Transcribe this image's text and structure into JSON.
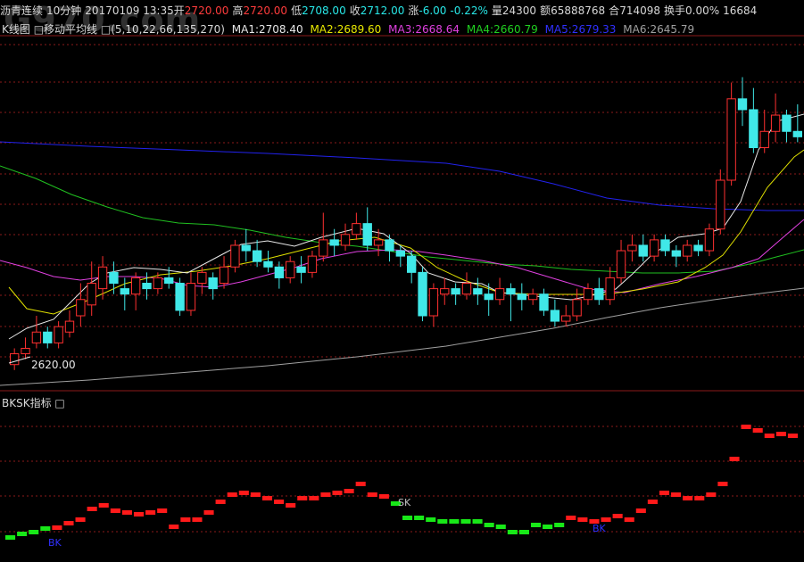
{
  "header": {
    "instrument": "沥青连续",
    "period": "10分钟",
    "datetime": "20170109 13:35",
    "open_label": "开",
    "open": "2720.00",
    "high_label": "高",
    "high": "2720.00",
    "low_label": "低",
    "low": "2708.00",
    "close_label": "收",
    "close": "2712.00",
    "change_label": "涨",
    "change": "-6.00",
    "change_pct": "-0.22%",
    "volume_label": "量",
    "volume": "24300",
    "amount_label": "额",
    "amount": "65888768",
    "oi_label": "合",
    "oi": "714098",
    "turnover_label": "换手",
    "turnover": "0.00%",
    "extra": "16684"
  },
  "ma_bar": {
    "kline_label": "K线图",
    "ma_name": "移动平均线",
    "params": "(5,10,22,66,135,270)",
    "ma1": "MA1:2708.40",
    "ma2": "MA2:2689.60",
    "ma3": "MA3:2668.64",
    "ma4": "MA4:2660.79",
    "ma5": "MA5:2679.33",
    "ma6": "MA6:2645.79",
    "colors": {
      "ma1": "#e8e8e8",
      "ma2": "#e8e800",
      "ma3": "#e040e0",
      "ma4": "#20d020",
      "ma5": "#2020ff",
      "ma6": "#b0b0b0"
    }
  },
  "sub_panel": {
    "title": "BKSK指标",
    "bk_label_1": "BK",
    "sk_label": "SK",
    "bk_label_2": "BK"
  },
  "price_annotation": "2620.00",
  "watermark": "G970.com",
  "chart_data": {
    "type": "candlestick",
    "ylim": [
      2615,
      2740
    ],
    "candles": [
      [
        2622,
        2626,
        2628,
        2620
      ],
      [
        2626,
        2628,
        2632,
        2624
      ],
      [
        2630,
        2634,
        2640,
        2628
      ],
      [
        2634,
        2630,
        2636,
        2628
      ],
      [
        2630,
        2636,
        2638,
        2628
      ],
      [
        2634,
        2638,
        2642,
        2632
      ],
      [
        2640,
        2646,
        2652,
        2636
      ],
      [
        2644,
        2652,
        2660,
        2640
      ],
      [
        2650,
        2658,
        2662,
        2646
      ],
      [
        2656,
        2652,
        2660,
        2648
      ],
      [
        2650,
        2648,
        2654,
        2642
      ],
      [
        2648,
        2654,
        2656,
        2642
      ],
      [
        2652,
        2650,
        2656,
        2646
      ],
      [
        2650,
        2654,
        2656,
        2648
      ],
      [
        2654,
        2652,
        2658,
        2650
      ],
      [
        2652,
        2642,
        2654,
        2640
      ],
      [
        2642,
        2652,
        2656,
        2640
      ],
      [
        2652,
        2656,
        2658,
        2648
      ],
      [
        2654,
        2650,
        2656,
        2646
      ],
      [
        2652,
        2658,
        2662,
        2650
      ],
      [
        2658,
        2666,
        2668,
        2656
      ],
      [
        2666,
        2664,
        2672,
        2660
      ],
      [
        2664,
        2660,
        2668,
        2658
      ],
      [
        2660,
        2658,
        2664,
        2656
      ],
      [
        2658,
        2654,
        2660,
        2650
      ],
      [
        2654,
        2660,
        2662,
        2652
      ],
      [
        2658,
        2656,
        2662,
        2652
      ],
      [
        2656,
        2662,
        2664,
        2654
      ],
      [
        2662,
        2668,
        2678,
        2660
      ],
      [
        2668,
        2666,
        2672,
        2662
      ],
      [
        2666,
        2670,
        2674,
        2664
      ],
      [
        2670,
        2674,
        2678,
        2668
      ],
      [
        2674,
        2666,
        2680,
        2664
      ],
      [
        2666,
        2668,
        2672,
        2662
      ],
      [
        2668,
        2664,
        2670,
        2660
      ],
      [
        2664,
        2662,
        2666,
        2658
      ],
      [
        2662,
        2656,
        2664,
        2652
      ],
      [
        2656,
        2640,
        2658,
        2638
      ],
      [
        2640,
        2650,
        2652,
        2636
      ],
      [
        2648,
        2650,
        2654,
        2644
      ],
      [
        2650,
        2648,
        2652,
        2644
      ],
      [
        2648,
        2652,
        2656,
        2646
      ],
      [
        2650,
        2648,
        2654,
        2644
      ],
      [
        2648,
        2646,
        2652,
        2640
      ],
      [
        2646,
        2650,
        2654,
        2644
      ],
      [
        2650,
        2648,
        2652,
        2638
      ],
      [
        2648,
        2646,
        2652,
        2642
      ],
      [
        2646,
        2648,
        2650,
        2644
      ],
      [
        2648,
        2642,
        2650,
        2640
      ],
      [
        2642,
        2638,
        2646,
        2636
      ],
      [
        2638,
        2640,
        2644,
        2636
      ],
      [
        2640,
        2646,
        2650,
        2638
      ],
      [
        2646,
        2650,
        2652,
        2644
      ],
      [
        2650,
        2646,
        2654,
        2644
      ],
      [
        2646,
        2654,
        2658,
        2644
      ],
      [
        2654,
        2664,
        2668,
        2652
      ],
      [
        2664,
        2666,
        2670,
        2660
      ],
      [
        2666,
        2662,
        2670,
        2660
      ],
      [
        2662,
        2668,
        2670,
        2660
      ],
      [
        2668,
        2664,
        2670,
        2662
      ],
      [
        2664,
        2662,
        2666,
        2658
      ],
      [
        2662,
        2666,
        2668,
        2660
      ],
      [
        2666,
        2664,
        2668,
        2662
      ],
      [
        2664,
        2672,
        2674,
        2662
      ],
      [
        2672,
        2690,
        2694,
        2670
      ],
      [
        2690,
        2720,
        2726,
        2688
      ],
      [
        2720,
        2716,
        2728,
        2710
      ],
      [
        2716,
        2702,
        2724,
        2700
      ],
      [
        2702,
        2708,
        2716,
        2700
      ],
      [
        2708,
        2714,
        2722,
        2704
      ],
      [
        2714,
        2708,
        2716,
        2704
      ],
      [
        2708,
        2706,
        2718,
        2704
      ]
    ]
  },
  "bksk_data": {
    "levels": [
      [
        -1,
        600
      ],
      [
        -1,
        596
      ],
      [
        -1,
        594
      ],
      [
        -1,
        590
      ],
      [
        1,
        589
      ],
      [
        1,
        584
      ],
      [
        1,
        580
      ],
      [
        1,
        568
      ],
      [
        1,
        564
      ],
      [
        1,
        570
      ],
      [
        1,
        572
      ],
      [
        1,
        574
      ],
      [
        1,
        572
      ],
      [
        1,
        570
      ],
      [
        1,
        588
      ],
      [
        1,
        580
      ],
      [
        1,
        580
      ],
      [
        1,
        572
      ],
      [
        1,
        560
      ],
      [
        1,
        552
      ],
      [
        1,
        550
      ],
      [
        1,
        552
      ],
      [
        1,
        556
      ],
      [
        1,
        560
      ],
      [
        1,
        564
      ],
      [
        1,
        556
      ],
      [
        1,
        556
      ],
      [
        1,
        552
      ],
      [
        1,
        550
      ],
      [
        1,
        548
      ],
      [
        1,
        540
      ],
      [
        1,
        552
      ],
      [
        1,
        554
      ],
      [
        -1,
        562
      ],
      [
        -1,
        578
      ],
      [
        -1,
        578
      ],
      [
        -1,
        580
      ],
      [
        -1,
        582
      ],
      [
        -1,
        582
      ],
      [
        -1,
        582
      ],
      [
        -1,
        582
      ],
      [
        -1,
        586
      ],
      [
        -1,
        588
      ],
      [
        -1,
        594
      ],
      [
        -1,
        594
      ],
      [
        -1,
        586
      ],
      [
        -1,
        588
      ],
      [
        -1,
        586
      ],
      [
        1,
        578
      ],
      [
        1,
        580
      ],
      [
        1,
        582
      ],
      [
        1,
        580
      ],
      [
        1,
        576
      ],
      [
        1,
        580
      ],
      [
        1,
        570
      ],
      [
        1,
        560
      ],
      [
        1,
        550
      ],
      [
        1,
        552
      ],
      [
        1,
        556
      ],
      [
        1,
        556
      ],
      [
        1,
        552
      ],
      [
        1,
        540
      ],
      [
        1,
        512
      ],
      [
        1,
        476
      ],
      [
        1,
        480
      ],
      [
        1,
        486
      ],
      [
        1,
        484
      ],
      [
        1,
        486
      ]
    ]
  }
}
